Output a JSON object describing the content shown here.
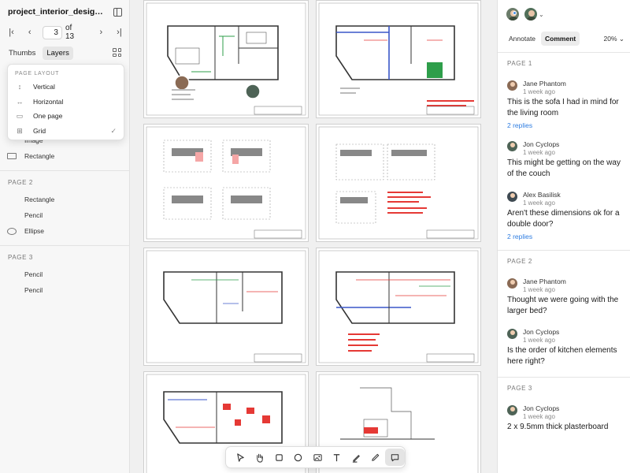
{
  "document": {
    "file_name": "project_interior_design_techn...",
    "current_page": "3",
    "page_total_label": "of 13"
  },
  "sidebar": {
    "tabs": [
      {
        "label": "Thumbs",
        "active": false
      },
      {
        "label": "Layers",
        "active": true
      }
    ],
    "layout_menu": {
      "heading": "PAGE LAYOUT",
      "items": [
        {
          "label": "Vertical",
          "icon": "vertical-layout-icon",
          "checked": false
        },
        {
          "label": "Horizontal",
          "icon": "horizontal-layout-icon",
          "checked": false
        },
        {
          "label": "One page",
          "icon": "one-page-icon",
          "checked": false
        },
        {
          "label": "Grid",
          "icon": "grid-layout-icon",
          "checked": true
        }
      ]
    },
    "layers": {
      "page1_items": [
        {
          "label": "Image",
          "icon": "image-icon"
        },
        {
          "label": "Rectangle",
          "icon": "rectangle-icon"
        }
      ],
      "page2_header": "PAGE 2",
      "page2_items": [
        {
          "label": "Rectangle",
          "icon": "rectangle-icon"
        },
        {
          "label": "Pencil",
          "icon": "pencil-icon"
        },
        {
          "label": "Ellipse",
          "icon": "ellipse-icon"
        }
      ],
      "page3_header": "PAGE 3",
      "page3_items": [
        {
          "label": "Pencil",
          "icon": "pencil-icon"
        },
        {
          "label": "Pencil",
          "icon": "pencil-icon"
        }
      ]
    }
  },
  "toolbar": {
    "tools": [
      {
        "name": "select-tool",
        "icon": "cursor-icon",
        "active": false
      },
      {
        "name": "pan-tool",
        "icon": "hand-icon",
        "active": false
      },
      {
        "name": "rectangle-tool",
        "icon": "square-icon",
        "active": false
      },
      {
        "name": "ellipse-tool",
        "icon": "circle-icon",
        "active": false
      },
      {
        "name": "image-tool",
        "icon": "image-icon",
        "active": false
      },
      {
        "name": "text-tool",
        "icon": "text-icon",
        "active": false
      },
      {
        "name": "highlighter-tool",
        "icon": "highlighter-icon",
        "active": false
      },
      {
        "name": "pencil-tool",
        "icon": "pencil-icon",
        "active": false
      },
      {
        "name": "comment-tool",
        "icon": "comment-icon",
        "active": true
      }
    ]
  },
  "right_panel": {
    "tabs": [
      {
        "label": "Annotate",
        "active": false
      },
      {
        "label": "Comment",
        "active": true
      }
    ],
    "zoom": "20%",
    "groups": [
      {
        "header": "PAGE 1",
        "comments": [
          {
            "author": "Jane Phantom",
            "time": "1 week ago",
            "text": "This is the sofa I had in mind for the living room",
            "replies": "2 replies"
          },
          {
            "author": "Jon Cyclops",
            "time": "1 week ago",
            "text": "This might be getting on the way of the couch",
            "replies": ""
          },
          {
            "author": "Alex Basilisk",
            "time": "1 week ago",
            "text": "Aren't these dimensions ok for a double door?",
            "replies": "2 replies"
          }
        ]
      },
      {
        "header": "PAGE 2",
        "comments": [
          {
            "author": "Jane Phantom",
            "time": "1 week ago",
            "text": "Thought we were going with the larger bed?",
            "replies": ""
          },
          {
            "author": "Jon Cyclops",
            "time": "1 week ago",
            "text": "Is the order of kitchen elements here right?",
            "replies": ""
          }
        ]
      },
      {
        "header": "PAGE 3",
        "comments": [
          {
            "author": "Jon Cyclops",
            "time": "1 week ago",
            "text": "2 x 9.5mm thick plasterboard",
            "replies": ""
          }
        ]
      }
    ]
  },
  "colors": {
    "accent_blue": "#2f7de1",
    "drawing_red": "#e53935",
    "drawing_green": "#2e9e4a",
    "drawing_blue": "#3a56c8"
  }
}
